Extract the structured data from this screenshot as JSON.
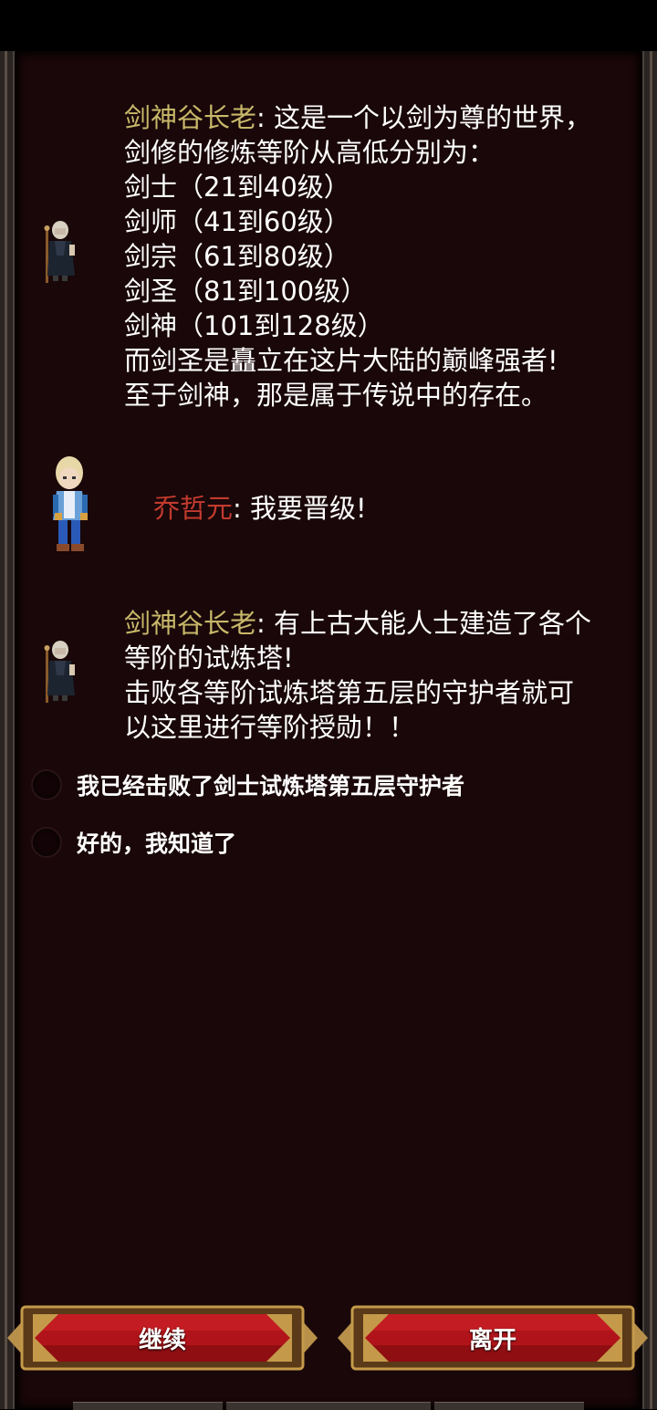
{
  "dialog": {
    "messages": [
      {
        "speaker": "剑神谷长老",
        "lines": [
          ": 这是一个以剑为尊的世界，",
          "剑修的修炼等阶从高低分别为：",
          "剑士（21到40级）",
          "剑师（41到60级）",
          "剑宗（61到80级）",
          "剑圣（81到100级）",
          "剑神（101到128级）",
          "而剑圣是矗立在这片大陆的巅峰强者!",
          "至于剑神，那是属于传说中的存在。"
        ]
      },
      {
        "speaker": "乔哲元",
        "lines": [
          ": 我要晋级!"
        ]
      },
      {
        "speaker": "剑神谷长老",
        "lines": [
          ": 有上古大能人士建造了各个",
          "等阶的试炼塔!",
          "击败各等阶试炼塔第五层的守护者就可",
          "以这里进行等阶授勋！！"
        ]
      }
    ],
    "options": [
      "我已经击败了剑士试炼塔第五层守护者",
      "好的，我知道了"
    ]
  },
  "buttons": {
    "continue": "继续",
    "leave": "离开"
  },
  "colors": {
    "elder_name": "#c8b86a",
    "player_name": "#c23a2e",
    "panel_bg": "#190709",
    "button_red": "#b0141a",
    "button_gold": "#c49a4a"
  },
  "icons": [
    "elder-avatar-icon",
    "player-avatar-icon",
    "radio-icon"
  ]
}
